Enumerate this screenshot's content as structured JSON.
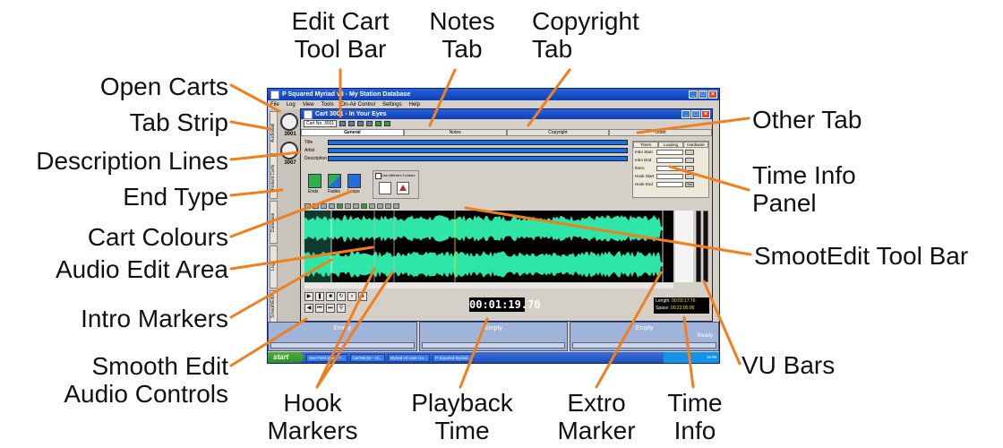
{
  "callouts": {
    "edit_cart_toolbar": [
      "Edit Cart",
      "Tool Bar"
    ],
    "notes_tab": [
      "Notes",
      "Tab"
    ],
    "copyright_tab": [
      "Copyright",
      "Tab"
    ],
    "open_carts": "Open Carts",
    "tab_strip": "Tab Strip",
    "description_lines": "Description Lines",
    "end_type": "End Type",
    "cart_colours": "Cart Colours",
    "audio_edit_area": "Audio Edit Area",
    "intro_markers": "Intro Markers",
    "smooth_edit_controls": [
      "Smooth Edit",
      "Audio Controls"
    ],
    "hook_markers": [
      "Hook",
      "Markers"
    ],
    "playback_time": [
      "Playback",
      "Time"
    ],
    "extro_marker": [
      "Extro",
      "Marker"
    ],
    "time_info": [
      "Time",
      "Info"
    ],
    "vu_bars": "VU Bars",
    "smootedit_toolbar": "SmootEdit Tool Bar",
    "time_info_panel": [
      "Time Info",
      "Panel"
    ],
    "other_tab": "Other Tab"
  },
  "app": {
    "title": "P Squared Myriad v3 - My Station Database",
    "menu": [
      "File",
      "Log",
      "View",
      "Tools",
      "On-Air Control",
      "Settings",
      "Help"
    ],
    "left_tabs": [
      "Audiowall",
      "Instant Carts",
      "Database",
      "Log",
      "SmoothEdit"
    ],
    "open_carts": [
      "3001",
      "3007"
    ],
    "cart_window": {
      "title": "Cart 3001 - In Your Eyes",
      "cart_no_label": "Cart No. 3001",
      "tabs": [
        "General",
        "Notes",
        "Copyright",
        "Other"
      ],
      "title_label": "Title",
      "artist_label": "Artist",
      "description_label": "Description",
      "use_colours_label": "Use different Colours",
      "end_buttons": [
        "Ends",
        "Fades",
        "Loops"
      ],
      "time_panel_tabs": [
        "Times",
        "Looping",
        "Hardware"
      ],
      "time_rows": [
        "Intro Start",
        "Intro End",
        "Extro",
        "Hook Start",
        "Hook End"
      ],
      "set_label": "Set",
      "play_time": "00:01:19.70",
      "length_label": "Length",
      "length_value": "00:03:17.76",
      "space_label": "Space",
      "space_value": "00:22:00.00"
    },
    "players": [
      {
        "label": "Empty"
      },
      {
        "label": "Empty"
      },
      {
        "label": "Empty",
        "status": "Ready"
      }
    ],
    "taskbar": {
      "start": "start",
      "tasks": [
        "See Field (Page F...",
        "CartWin32 - Ci...",
        "Myriad v3 User Gu...",
        "P Squared Myriad..."
      ],
      "clock": "15:09"
    }
  },
  "colors": {
    "leader": "#f07f1e",
    "waveform": "#2ee6a8",
    "title_bar": "#0b3fb8",
    "field_blue": "#1f6fe0"
  }
}
